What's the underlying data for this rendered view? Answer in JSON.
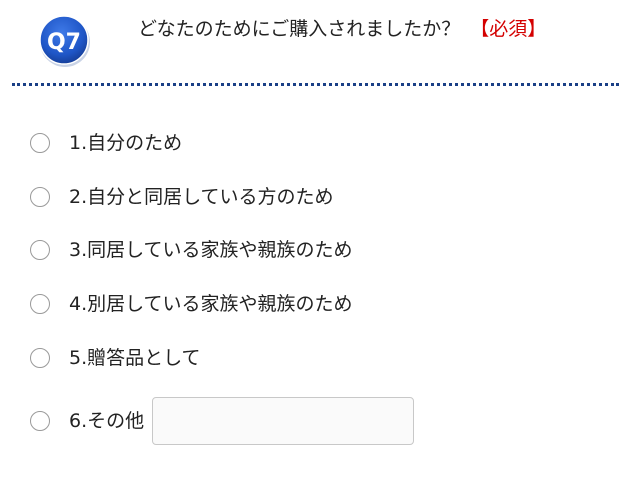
{
  "question": {
    "badge_text": "Q7",
    "title": "どなたのためにご購入されましたか？",
    "required_label": "【必須】",
    "badge_color": "#1f56c7",
    "required_color": "#d40000",
    "divider_color": "#1a3f86"
  },
  "options": [
    {
      "label": "1.自分のため"
    },
    {
      "label": "2.自分と同居している方のため"
    },
    {
      "label": "3.同居している家族や親族のため"
    },
    {
      "label": "4.別居している家族や親族のため"
    },
    {
      "label": "5.贈答品として"
    },
    {
      "label": "6.その他",
      "input_value": ""
    }
  ]
}
